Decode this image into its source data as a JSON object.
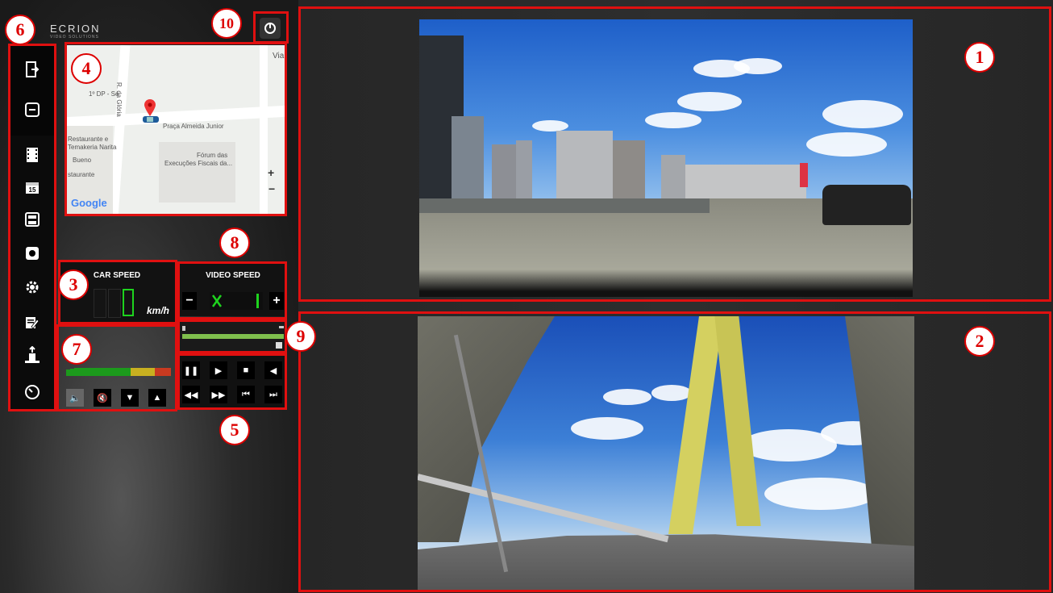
{
  "app": {
    "logo_text": "ECRION",
    "logo_sub": "VIDEO SOLUTIONS"
  },
  "badges": [
    "1",
    "2",
    "3",
    "4",
    "5",
    "6",
    "7",
    "8",
    "9",
    "10"
  ],
  "car_speed": {
    "title": "CAR SPEED",
    "unit": "km/h",
    "value": "0"
  },
  "video_speed": {
    "title": "VIDEO SPEED",
    "minus": "−",
    "plus": "+",
    "value": "1"
  },
  "map": {
    "labels": [
      "1º DP - Sé",
      "R. da Glória",
      "Praça Almeida Junior",
      "Restaurante e",
      "Temakeria Narita",
      "Bueno",
      "staurante",
      "Fórum das",
      "Execuções Fiscais da...",
      "Via"
    ],
    "google": "Google",
    "zoom_in": "+",
    "zoom_out": "−"
  },
  "sidebar": {
    "items": [
      "exit-icon",
      "minimize-icon",
      "film-icon",
      "calendar-icon",
      "save-icon",
      "camera-icon",
      "settings-icon",
      "edit-icon",
      "export-icon",
      "clock-icon"
    ],
    "calendar_day": "15"
  },
  "volume": {
    "level": 0.75
  },
  "playback": {
    "row1": [
      "❚❚",
      "▶",
      "■",
      "◀"
    ],
    "row2": [
      "◀◀",
      "▶▶",
      "⏮",
      "⏭"
    ]
  },
  "volume_buttons": [
    "🔈",
    "🔇",
    "▼",
    "▲"
  ],
  "timeline": {
    "progress": 0.0
  }
}
